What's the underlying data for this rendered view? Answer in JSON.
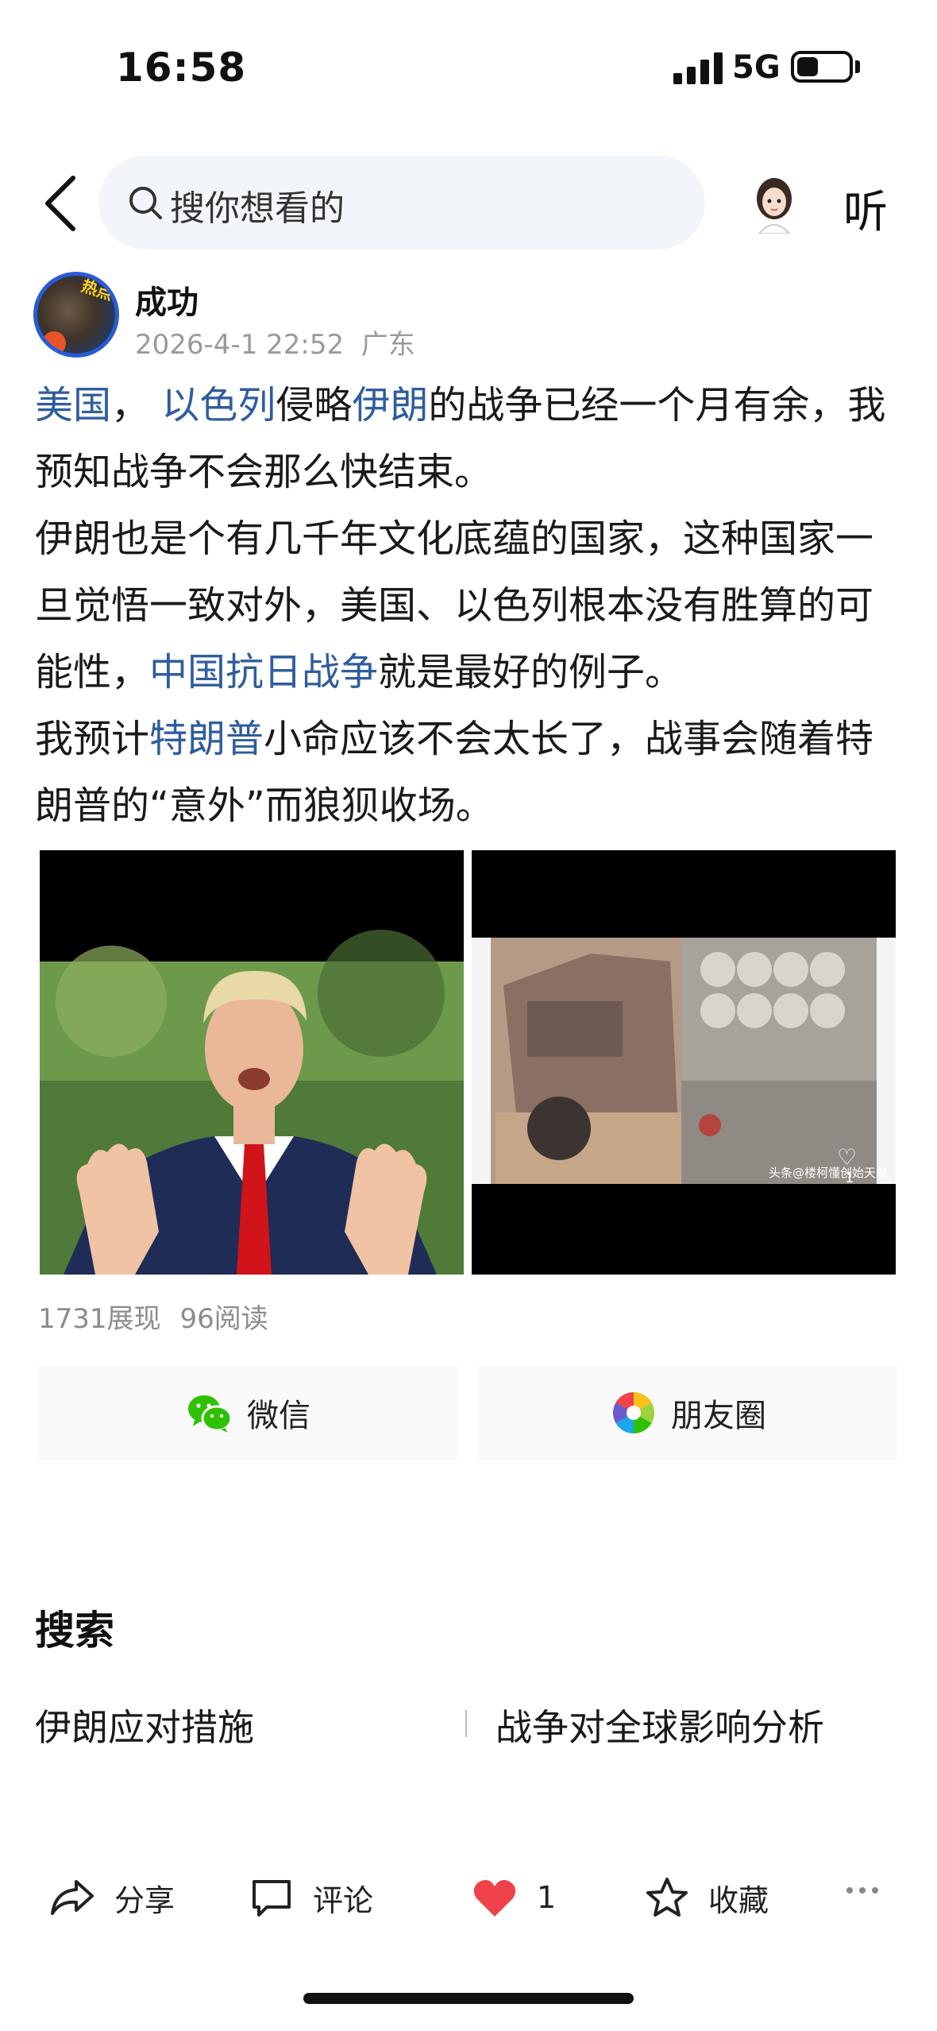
{
  "status_bar": {
    "time": "16:58",
    "network": "5G"
  },
  "nav": {
    "search_placeholder": "搜你想看的",
    "listen_label": "听"
  },
  "author": {
    "name": "成功",
    "timestamp": "2026-4-1 22:52",
    "location": "广东",
    "avatar_text": "热点"
  },
  "post": {
    "p1": {
      "a": "美国",
      "b": "，",
      "c": "以色列",
      "d": "侵略",
      "e": "伊朗",
      "f": "的战争已经一个月有余，我预知战争不会那么快结束。"
    },
    "p2": {
      "a": "伊朗也是个有几千年文化底蕴的国家，这种国家一旦觉悟一致对外，美国、以色列根本没有胜算的可能性，",
      "b": "中国抗日战争",
      "c": "就是最好的例子。"
    },
    "p3": {
      "a": "我预计",
      "b": "特朗普",
      "c": "小命应该不会太长了，战事会随着特朗普的“意外”而狼狈收场。"
    }
  },
  "images": {
    "right_watermark": "头条@楼柯懂创始天魔",
    "right_like_count": "1"
  },
  "stats": {
    "views": "1731展现",
    "reads": "96阅读"
  },
  "share": {
    "wechat": "微信",
    "moments": "朋友圈"
  },
  "search_section": {
    "title": "搜索",
    "suggestions": [
      "伊朗应对措施",
      "战争对全球影响分析"
    ]
  },
  "actions": {
    "share": "分享",
    "comment": "评论",
    "like_count": "1",
    "favorite": "收藏"
  },
  "colors": {
    "link": "#2f5d9e",
    "like_red": "#f0424b",
    "search_bg": "#f2f5f9"
  }
}
